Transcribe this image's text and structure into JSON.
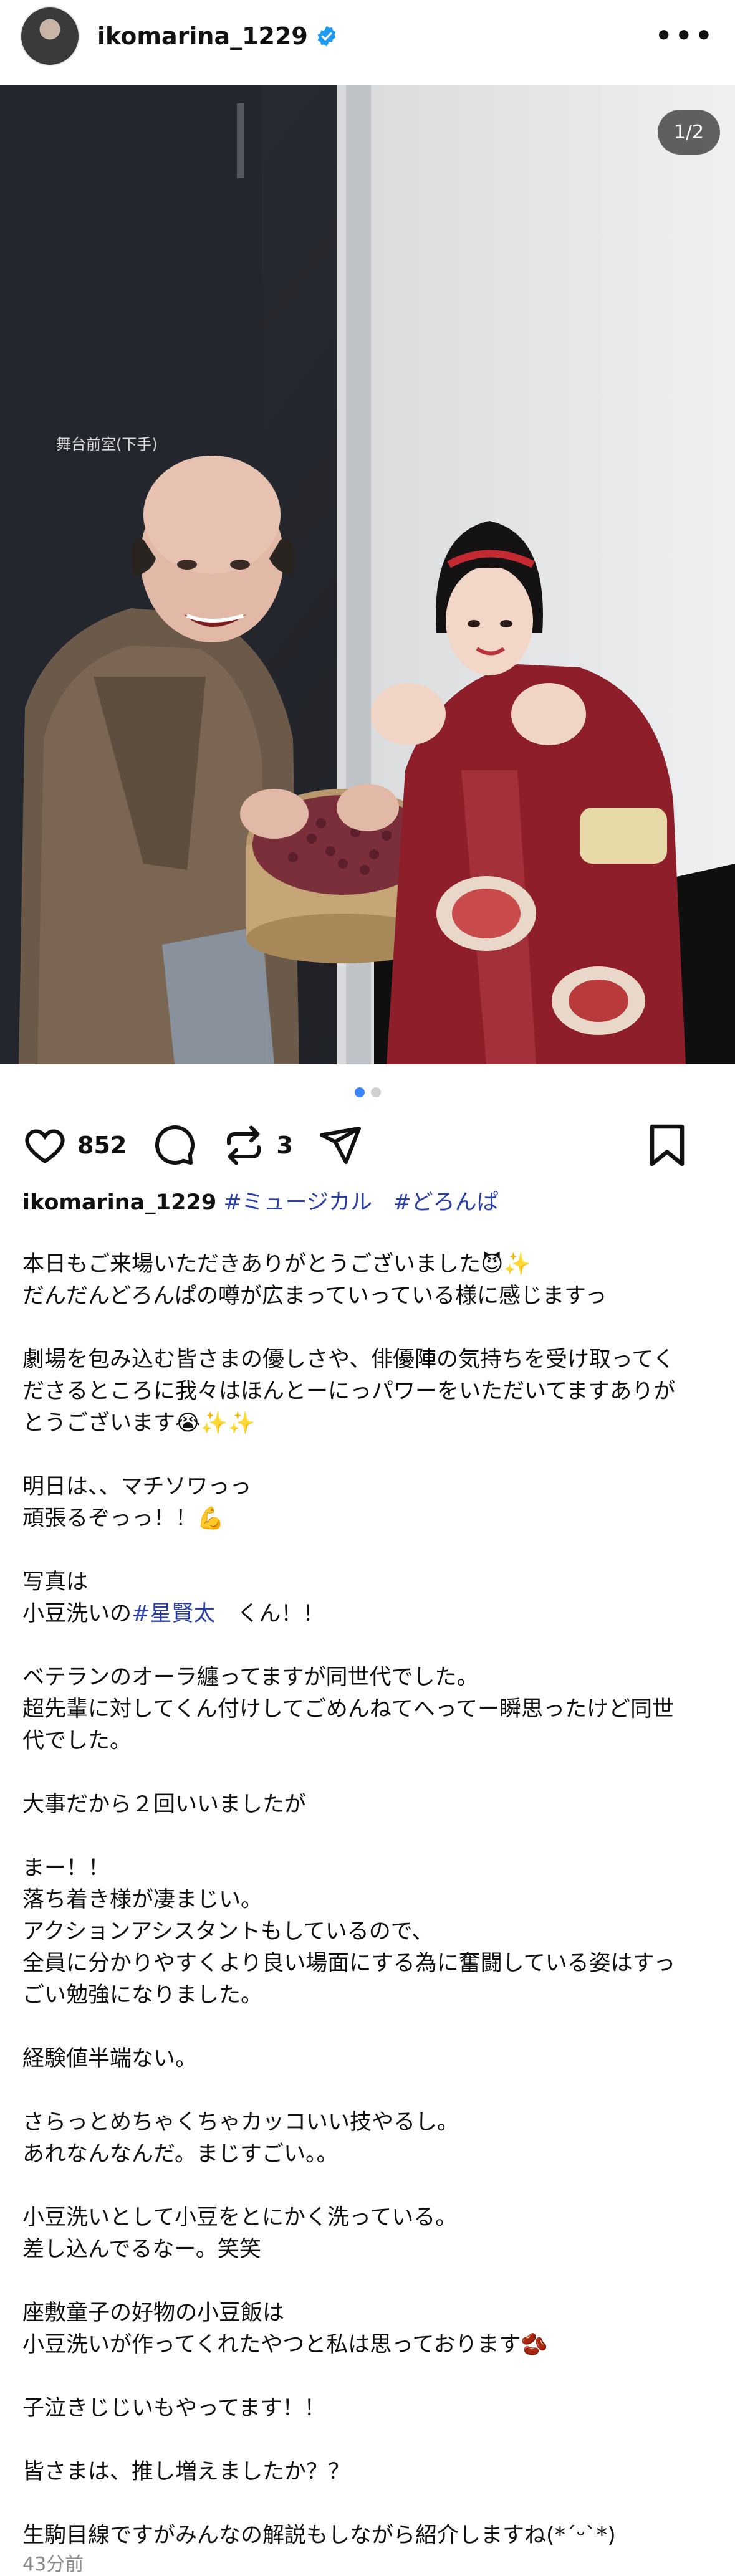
{
  "header": {
    "username": "ikomarina_1229",
    "more_label": "•••"
  },
  "photo": {
    "counter": "1/2",
    "door_sign": "舞台前室(下手)"
  },
  "carousel": {
    "current": 1,
    "total": 2
  },
  "actions": {
    "likes": "852",
    "reposts": "3"
  },
  "caption": {
    "username": "ikomarina_1229",
    "tag1": "#ミュージカル",
    "tag2": "#どろんぱ",
    "line1": "本日もご来場いただきありがとうございました😈✨",
    "line2": "だんだんどろんぱの噂が広まっていっている様に感じますっ",
    "line3": "劇場を包み込む皆さまの優しさや、俳優陣の気持ちを受け取ってく",
    "line4": "ださるところに我々はほんとーにっパワーをいただいてますありが",
    "line5": "とうございます😭✨✨",
    "line6": "明日は、、マチソワっっ",
    "line7": "頑張るぞっっ！！💪",
    "line8": "写真は",
    "line9_pre": "小豆洗いの",
    "line9_tag": "#星賢太",
    "line9_post": "　くん！！",
    "line10": "ベテランのオーラ纏ってますが同世代でした。",
    "line11": "超先輩に対してくん付けしてごめんねてへってー瞬思ったけど同世",
    "line12": "代でした。",
    "line13": "大事だから２回いいましたが",
    "line14": "まー！！",
    "line15": "落ち着き様が凄まじい。",
    "line16": "アクションアシスタントもしているので、",
    "line17": "全員に分かりやすくより良い場面にする為に奮闘している姿はすっ",
    "line18": "ごい勉強になりました。",
    "line19": "経験値半端ない。",
    "line20": "さらっとめちゃくちゃカッコいい技やるし。",
    "line21": "あれなんなんだ。まじすごい。。",
    "line22": "小豆洗いとして小豆をとにかく洗っている。",
    "line23": "差し込んでるなー。笑笑",
    "line24": "座敷童子の好物の小豆飯は",
    "line25": "小豆洗いが作ってくれたやつと私は思っております🫘",
    "line26": "子泣きじじいもやってます！！",
    "line27": "皆さまは、推し増えましたか？？",
    "line28": "生駒目線ですがみんなの解説もしながら紹介しますね(*´ᵕ`*)"
  },
  "timestamp": "43分前",
  "colors": {
    "accent_blue": "#3a86ff",
    "hashtag": "#2b3fa8",
    "verified": "#1d9bf0"
  },
  "icons": [
    "avatar",
    "verified-badge-icon",
    "more-icon",
    "heart-icon",
    "comment-icon",
    "repost-icon",
    "share-icon",
    "bookmark-icon"
  ]
}
